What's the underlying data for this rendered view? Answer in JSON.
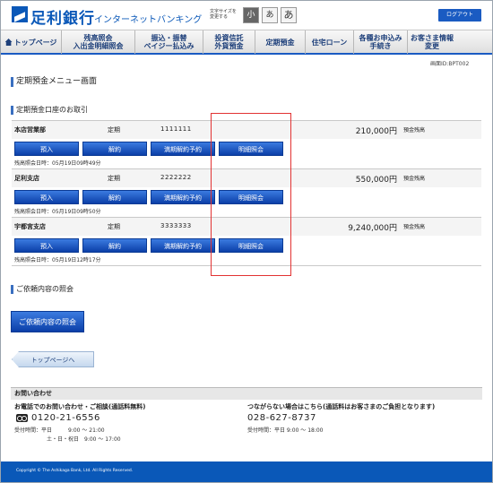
{
  "header": {
    "logo_text": "足利銀行",
    "logo_sub": "インターネットバンキング",
    "fontsize_label": "文字サイズを変更する",
    "fontsize_options": [
      "小",
      "あ",
      "あ"
    ],
    "logout_label": "ログアウト"
  },
  "nav": {
    "items": [
      {
        "label": "トップページ"
      },
      {
        "label": "残高照会\n入出金明細照会"
      },
      {
        "label": "振込・振替\nペイジー払込み"
      },
      {
        "label": "投資信託\n外貨預金"
      },
      {
        "label": "定期預金"
      },
      {
        "label": "住宅ローン"
      },
      {
        "label": "各種お申込み\n手続き"
      },
      {
        "label": "お客さま情報\n変更"
      }
    ]
  },
  "screen_id": "画面ID:BPT002",
  "page_title": "定期預金メニュー画面",
  "section_title": "定期預金口座のお取引",
  "accounts": [
    {
      "branch": "本店営業部",
      "type": "定期",
      "number": "1111111",
      "balance": "210,000円",
      "balance_label": "預金残高",
      "time": "残高照会日時：05月19日09時49分"
    },
    {
      "branch": "足利支店",
      "type": "定期",
      "number": "2222222",
      "balance": "550,000円",
      "balance_label": "預金残高",
      "time": "残高照会日時：05月19日09時50分"
    },
    {
      "branch": "宇都宮支店",
      "type": "定期",
      "number": "3333333",
      "balance": "9,240,000円",
      "balance_label": "預金残高",
      "time": "残高照会日時：05月19日12時17分"
    }
  ],
  "buttons": {
    "deposit": "預入",
    "cancel": "解約",
    "maturity": "満期解約予約",
    "detail": "明細照会"
  },
  "inquiry_section_title": "ご依頼内容の照会",
  "inquiry_button": "ご依頼内容の照会",
  "top_button": "トップページへ",
  "contact": {
    "head": "お問い合わせ",
    "left_title": "お電話でのお問い合わせ・ご相談(通話料無料)",
    "left_tel": "0120-21-6556",
    "left_hours1": "受付時間：平日　　　9:00 ～ 21:00",
    "left_hours2": "土・日・祝日　9:00 ～ 17:00",
    "right_title": "つながらない場合はこちら(通話料はお客さまのご負担となります)",
    "right_tel": "028-627-8737",
    "right_hours": "受付時間：平日 9:00 ～ 18:00"
  },
  "footer": "Copyright © The Ashikaga Bank, Ltd. All Rights Reserved."
}
